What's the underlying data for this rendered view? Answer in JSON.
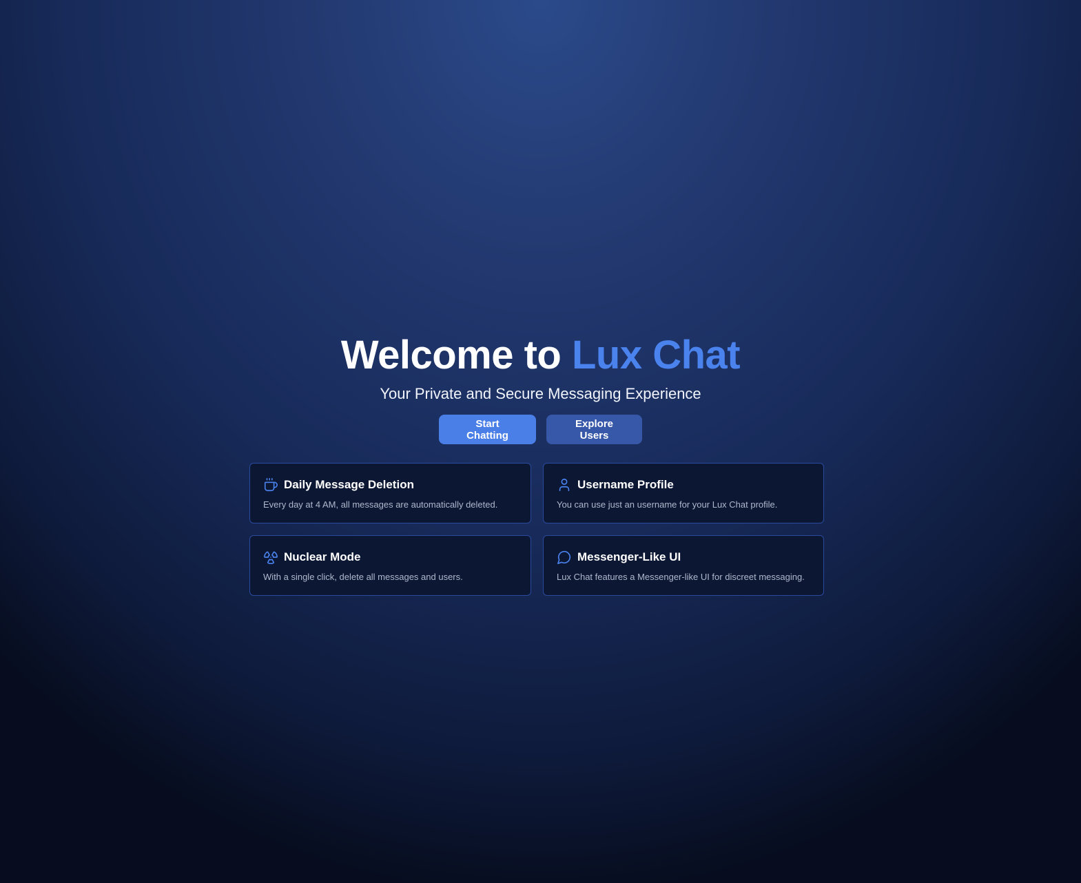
{
  "hero": {
    "title_prefix": "Welcome to",
    "title_brand": "Lux Chat",
    "subtitle": "Your Private and Secure Messaging Experience"
  },
  "actions": {
    "start_label": "Start Chatting",
    "explore_label": "Explore Users"
  },
  "features": [
    {
      "icon": "coffee-cup-icon",
      "title": "Daily Message Deletion",
      "description": "Every day at 4 AM, all messages are automatically deleted."
    },
    {
      "icon": "user-icon",
      "title": "Username Profile",
      "description": "You can use just an username for your Lux Chat profile."
    },
    {
      "icon": "radiation-icon",
      "title": "Nuclear Mode",
      "description": "With a single click, delete all messages and users."
    },
    {
      "icon": "message-circle-icon",
      "title": "Messenger-Like UI",
      "description": "Lux Chat features a Messenger-like UI for discreet messaging."
    }
  ],
  "colors": {
    "accent": "#4a82ee",
    "primary_button": "#4a7fe8",
    "secondary_button": "#3757a8",
    "card_background": "#0c1733",
    "card_border": "#2a4a9e"
  }
}
